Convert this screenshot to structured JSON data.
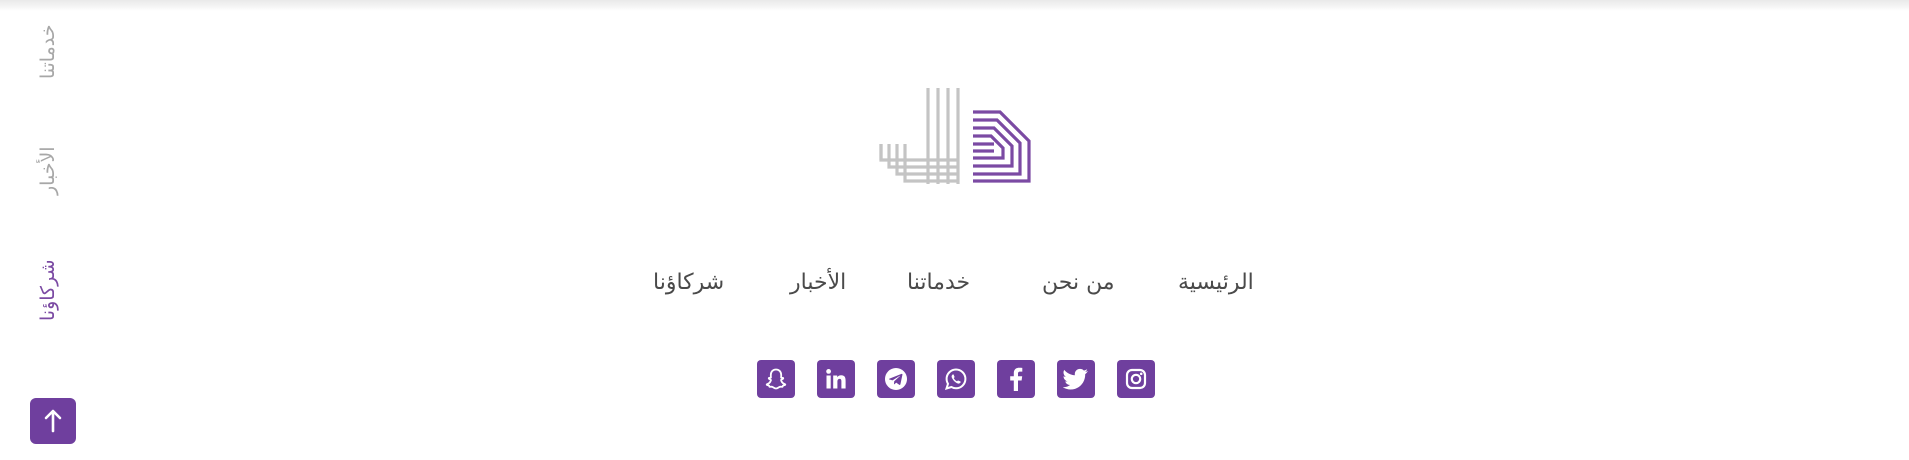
{
  "side_nav": {
    "items": [
      {
        "label": "خدماتنا",
        "active": false
      },
      {
        "label": "الأخبار",
        "active": false
      },
      {
        "label": "شركاؤنا",
        "active": true
      }
    ]
  },
  "scroll_top": {
    "icon": "arrow-up-icon"
  },
  "logo": {
    "icon": "dal-logo",
    "colors": {
      "lines": "#c4c4c4",
      "accent": "#7b4aa3"
    }
  },
  "main_nav": {
    "items": [
      {
        "label": "الرئيسية"
      },
      {
        "label": "من نحن"
      },
      {
        "label": "خدماتنا"
      },
      {
        "label": "الأخبار"
      },
      {
        "label": "شركاؤنا"
      }
    ]
  },
  "social": {
    "items": [
      {
        "icon": "instagram-icon"
      },
      {
        "icon": "twitter-icon"
      },
      {
        "icon": "facebook-icon"
      },
      {
        "icon": "whatsapp-icon"
      },
      {
        "icon": "telegram-icon"
      },
      {
        "icon": "linkedin-icon"
      },
      {
        "icon": "snapchat-icon"
      }
    ]
  },
  "colors": {
    "accent": "#6f3f9e",
    "side_text": "#a7a7a7",
    "nav_text": "#4a4a4a",
    "logo_gray": "#c4c4c4"
  }
}
